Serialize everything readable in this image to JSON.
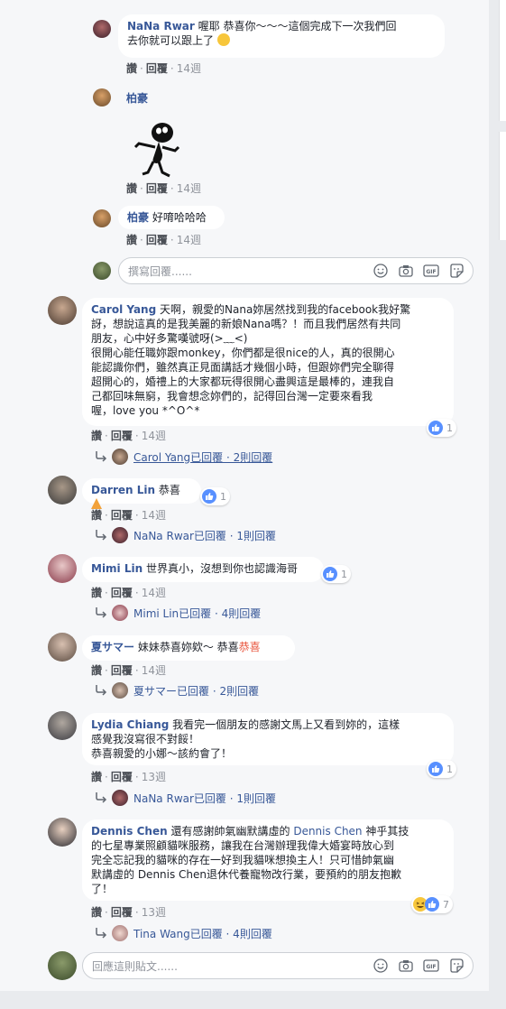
{
  "labels": {
    "like": "讚",
    "reply": "回覆",
    "dot": "·"
  },
  "comments": {
    "nana1": {
      "name": "NaNa Rwar",
      "text": "喔耶 恭喜你～～～這個完成下一次我們回",
      "text2": "去你就可以跟上了",
      "time": "14週"
    },
    "bohao1": {
      "name": "柏豪",
      "time": "14週"
    },
    "bohao2": {
      "name": "柏豪",
      "text": "好唷哈哈哈",
      "time": "14週"
    },
    "carol": {
      "name": "Carol Yang",
      "line1": "天啊，親愛的Nana妳居然找到我的facebook我好驚",
      "line2": "訝，想說這真的是我美麗的新娘Nana嗎？！而且我們居然有共同",
      "line3": "朋友，心中好多驚嘆號呀(>﹏<)",
      "line4": "很開心能任職妳跟monkey，你們都是很nice的人，真的很開心",
      "line5": "能認識你們，雖然真正見面講話才幾個小時，但跟妳們完全聊得",
      "line6": "超開心的，婚禮上的大家都玩得很開心盡興這是最棒的，連我自",
      "line7": "己都回味無窮，我會想念妳們的，記得回台灣一定要來看我",
      "line8": "喔，love you *^O^*",
      "time": "14週",
      "reactions": "1",
      "reply_summary": "Carol Yang已回覆 · 2則回覆"
    },
    "darren": {
      "name": "Darren Lin",
      "text": "恭喜",
      "time": "14週",
      "reactions": "1",
      "reply_summary": "NaNa Rwar已回覆 · 1則回覆"
    },
    "mimi": {
      "name": "Mimi Lin",
      "text": "世界真小，沒想到你也認識海哥",
      "time": "14週",
      "reactions": "1",
      "reply_summary": "Mimi Lin已回覆 · 4則回覆"
    },
    "natsu": {
      "name": "夏サマー",
      "text": "妹妹恭喜妳欸～ 恭喜",
      "highlight": "恭喜",
      "time": "14週",
      "reply_summary": "夏サマー已回覆 · 2則回覆"
    },
    "lydia": {
      "name": "Lydia Chiang",
      "line1": "我看完一個朋友的感謝文馬上又看到妳的，這樣",
      "line2": "感覺我沒寫很不對餒！",
      "line3": "恭喜親愛的小娜～該約會了！",
      "time": "13週",
      "reactions": "1",
      "reply_summary": "NaNa Rwar已回覆 · 1則回覆"
    },
    "dennis": {
      "name": "Dennis Chen",
      "line1a": "還有感謝帥氣幽默講虛的",
      "line1b": "Dennis Chen",
      "line1c": "神乎其技",
      "line2": "的七星專業照顧貓咪服務，讓我在台灣辦理我偉大婚宴時放心到",
      "line3": "完全忘記我的貓咪的存在一好到我貓咪想換主人！只可惜帥氣幽",
      "line4": "默講虛的 Dennis Chen退休代養寵物改行業，要預約的朋友抱歉",
      "line5": "了！",
      "time": "13週",
      "reactions": "7",
      "reply_summary": "Tina Wang已回覆 · 4則回覆"
    }
  },
  "composer_reply": {
    "placeholder": "撰寫回覆......"
  },
  "composer_main": {
    "placeholder": "回應這則貼文......"
  },
  "colors": {
    "link": "#385898",
    "like_blue": "#5890ff",
    "bubble": "#ffffff",
    "bg": "#f6f7f9"
  },
  "icons": [
    "emoji-icon",
    "camera-icon",
    "gif-icon",
    "sticker-icon",
    "like-reaction-icon",
    "haha-reaction-icon",
    "reply-arrow-icon"
  ]
}
